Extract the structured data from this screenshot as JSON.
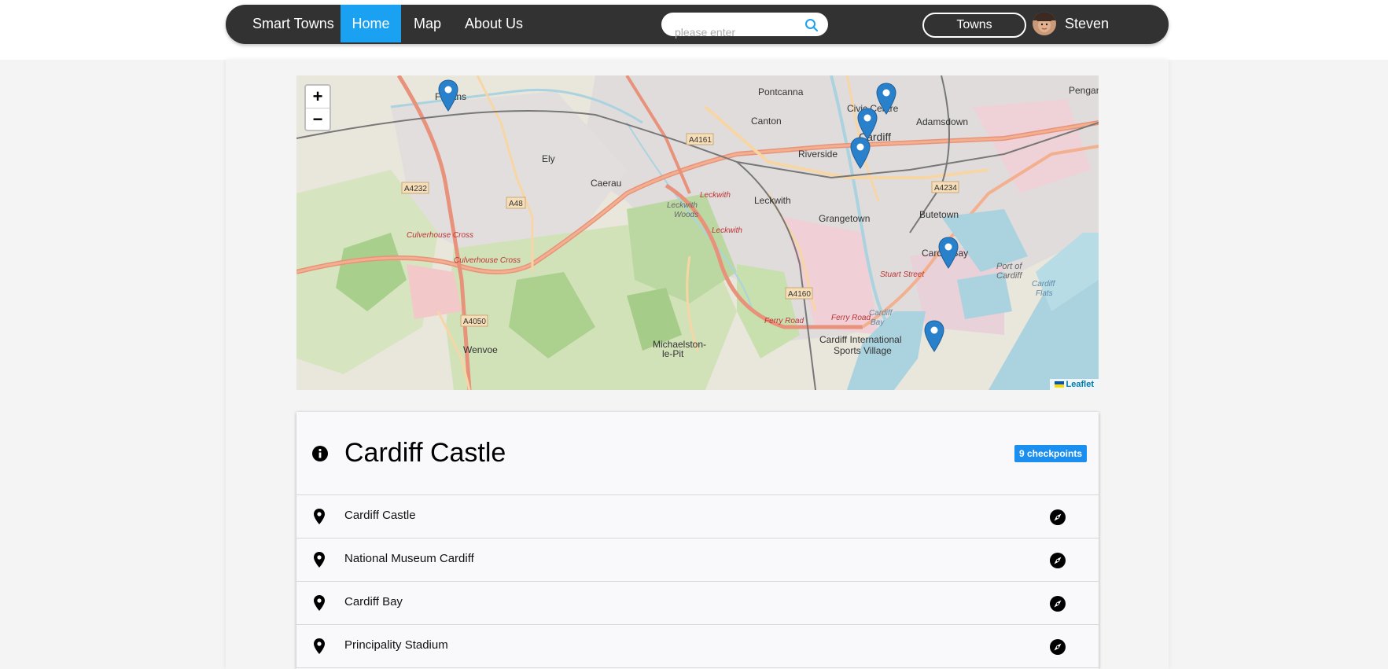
{
  "nav": {
    "brand": "Smart Towns",
    "home": "Home",
    "map": "Map",
    "about": "About Us",
    "search_placeholder": "please enter",
    "towns_button": "Towns",
    "username": "Steven"
  },
  "map": {
    "zoom_in": "+",
    "zoom_out": "−",
    "attribution": "Leaflet",
    "place_labels": [
      "Fagans",
      "Pontcanna",
      "Canton",
      "Civic Centre",
      "Cardiff",
      "Adamsdown",
      "Riverside",
      "Ely",
      "Caerau",
      "Leckwith",
      "Grangetown",
      "Butetown",
      "Cardiff Bay",
      "Culverhouse Cross",
      "Port of Cardiff",
      "Cardiff Flats",
      "Stuart Street",
      "Ferry Road",
      "Cardiff International Sports Village",
      "Michaelston-le-Pit",
      "Wenvoe",
      "Leckwith Woods",
      "Pengam"
    ],
    "road_labels": [
      "A4161",
      "A4232",
      "A48",
      "A4234",
      "A4160",
      "A4050"
    ],
    "marker_count": 6
  },
  "card": {
    "title": "Cardiff Castle",
    "badge": "9 checkpoints",
    "checkpoints": [
      "Cardiff Castle",
      "National Museum Cardiff",
      "Cardiff Bay",
      "Principality Stadium"
    ]
  },
  "colors": {
    "navbar": "#323232",
    "accent": "#1ba1f2",
    "badge": "#1b8ff0",
    "marker": "#2a81cb"
  }
}
